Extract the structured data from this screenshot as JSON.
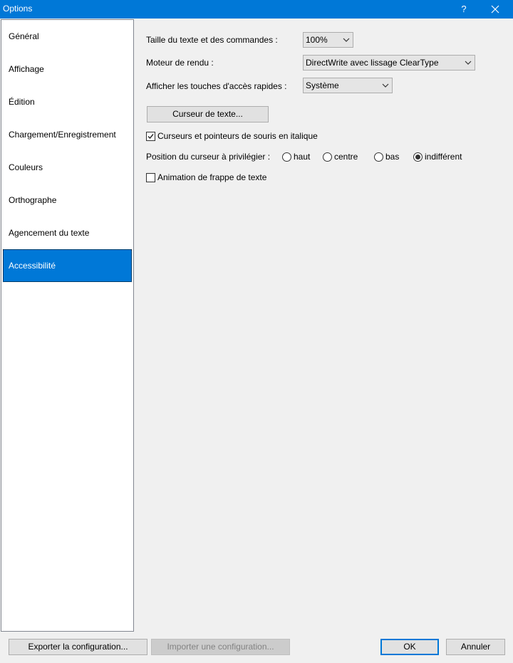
{
  "window": {
    "title": "Options",
    "help_glyph": "?",
    "close_glyph": "✕"
  },
  "nav": {
    "items": [
      {
        "label": "Général"
      },
      {
        "label": "Affichage"
      },
      {
        "label": "Édition"
      },
      {
        "label": "Chargement/Enregistrement"
      },
      {
        "label": "Couleurs"
      },
      {
        "label": "Orthographe"
      },
      {
        "label": "Agencement du texte"
      },
      {
        "label": "Accessibilité"
      }
    ],
    "selected_index": 7
  },
  "accessibility": {
    "text_size_label": "Taille du texte et des commandes :",
    "text_size_value": "100%",
    "render_engine_label": "Moteur de rendu :",
    "render_engine_value": "DirectWrite avec lissage ClearType",
    "access_keys_label": "Afficher les touches d'accès rapides :",
    "access_keys_value": "Système",
    "text_cursor_button": "Curseur de texte...",
    "italic_cursors_label": "Curseurs et pointeurs de souris en italique",
    "italic_cursors_checked": true,
    "cursor_position_label": "Position du curseur à privilégier :",
    "cursor_position_options": [
      "haut",
      "centre",
      "bas",
      "indifférent"
    ],
    "cursor_position_selected": "indifférent",
    "typing_animation_label": "Animation de frappe de texte",
    "typing_animation_checked": false
  },
  "footer": {
    "export_button": "Exporter la configuration...",
    "import_button": "Importer une configuration...",
    "ok_button": "OK",
    "cancel_button": "Annuler"
  },
  "colors": {
    "accent": "#0078d7",
    "background": "#f0f0f0"
  }
}
